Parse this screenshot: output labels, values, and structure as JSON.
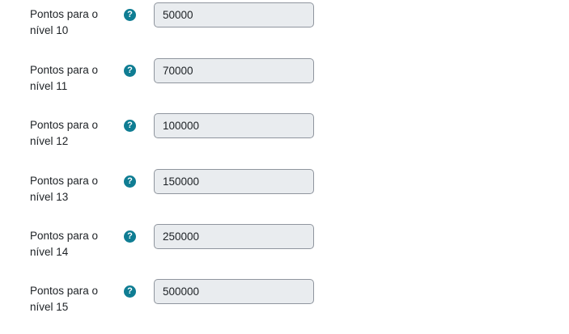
{
  "help_icon": "question-circle-icon",
  "colors": {
    "help_icon_bg": "#0f7d93",
    "field_bg": "#e9ecef",
    "field_border": "#8f959e"
  },
  "rows": [
    {
      "label_line1": "Pontos para o",
      "label_line2": "nível 10",
      "value": "50000"
    },
    {
      "label_line1": "Pontos para o",
      "label_line2": "nível 11",
      "value": "70000"
    },
    {
      "label_line1": "Pontos para o",
      "label_line2": "nível 12",
      "value": "100000"
    },
    {
      "label_line1": "Pontos para o",
      "label_line2": "nível 13",
      "value": "150000"
    },
    {
      "label_line1": "Pontos para o",
      "label_line2": "nível 14",
      "value": "250000"
    },
    {
      "label_line1": "Pontos para o",
      "label_line2": "nível 15",
      "value": "500000"
    }
  ]
}
